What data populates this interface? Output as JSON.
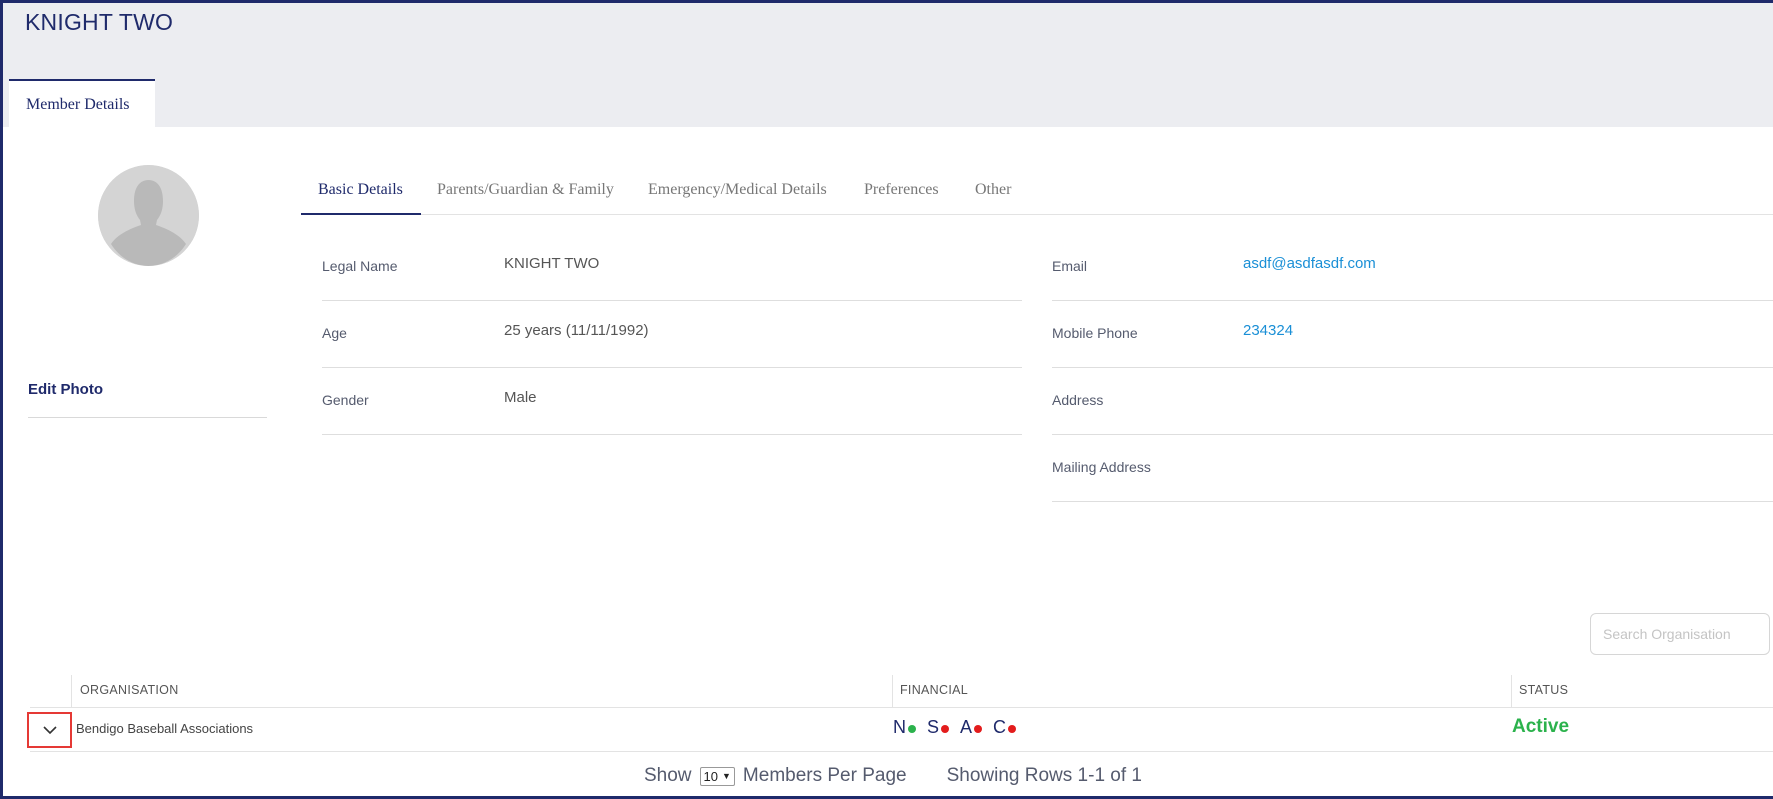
{
  "header": {
    "title": "KNIGHT TWO",
    "main_tab": "Member Details"
  },
  "photo": {
    "edit_label": "Edit Photo"
  },
  "subtabs": [
    {
      "label": "Basic Details",
      "active": true
    },
    {
      "label": "Parents/Guardian & Family",
      "active": false
    },
    {
      "label": "Emergency/Medical Details",
      "active": false
    },
    {
      "label": "Preferences",
      "active": false
    },
    {
      "label": "Other",
      "active": false
    }
  ],
  "details_left": [
    {
      "label": "Legal Name",
      "value": "KNIGHT TWO"
    },
    {
      "label": "Age",
      "value": "25 years (11/11/1992)"
    },
    {
      "label": "Gender",
      "value": "Male"
    }
  ],
  "details_right": [
    {
      "label": "Email",
      "value": "asdf@asdfasdf.com"
    },
    {
      "label": "Mobile Phone",
      "value": "234324"
    },
    {
      "label": "Address",
      "value": ""
    },
    {
      "label": "Mailing Address",
      "value": ""
    }
  ],
  "search": {
    "placeholder": "Search Organisation"
  },
  "table": {
    "columns": [
      "ORGANISATION",
      "FINANCIAL",
      "STATUS"
    ],
    "rows": [
      {
        "organisation": "Bendigo Baseball Associations",
        "financial": [
          {
            "letter": "N",
            "color": "#2bb24c"
          },
          {
            "letter": "S",
            "color": "#e31c1c"
          },
          {
            "letter": "A",
            "color": "#e31c1c"
          },
          {
            "letter": "C",
            "color": "#e31c1c"
          }
        ],
        "status": "Active"
      }
    ]
  },
  "pager": {
    "show_label": "Show",
    "per_page": "10",
    "per_page_label": "Members Per Page",
    "rows_info": "Showing Rows 1-1 of 1"
  },
  "colors": {
    "brand": "#1f2a6b",
    "link": "#1a8fd6",
    "active_status": "#2bb24c",
    "header_bg": "#ecedf1"
  }
}
